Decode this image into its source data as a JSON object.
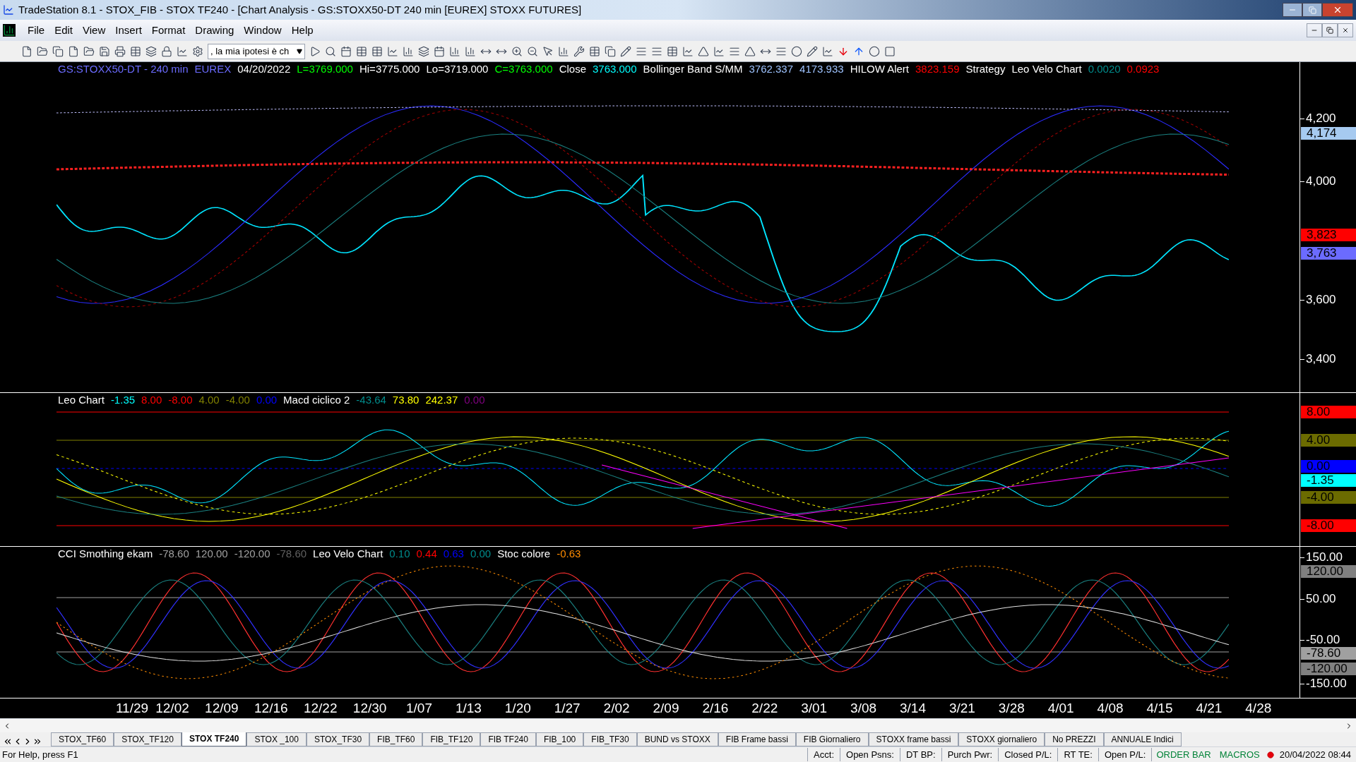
{
  "window": {
    "title": "TradeStation 8.1 - STOX_FIB - STOX TF240 - [Chart Analysis - GS:STOXX50-DT  240 min  [EUREX] STOXX FUTURES]"
  },
  "menu": [
    "File",
    "Edit",
    "View",
    "Insert",
    "Format",
    "Drawing",
    "Window",
    "Help"
  ],
  "toolbar": {
    "combo_value": ", la mia ipotesi è ch"
  },
  "price_pane": {
    "legend": [
      {
        "text": "GS:STOXX50-DT - 240 min",
        "color": "#6b6bff"
      },
      {
        "text": "EUREX",
        "color": "#6b6bff"
      },
      {
        "text": "04/20/2022",
        "color": "#ffffff"
      },
      {
        "text": "L=3769.000",
        "color": "#00ff00"
      },
      {
        "text": "Hi=3775.000",
        "color": "#ffffff"
      },
      {
        "text": "Lo=3719.000",
        "color": "#ffffff"
      },
      {
        "text": "C=3763.000",
        "color": "#00ff00"
      },
      {
        "text": "Close",
        "color": "#ffffff"
      },
      {
        "text": "3763.000",
        "color": "#00ffff"
      },
      {
        "text": "Bollinger Band S/MM",
        "color": "#ffffff"
      },
      {
        "text": "3762.337",
        "color": "#9ec3ff"
      },
      {
        "text": "4173.933",
        "color": "#9ec3ff"
      },
      {
        "text": "HILOW Alert",
        "color": "#ffffff"
      },
      {
        "text": "3823.159",
        "color": "#ff0000"
      },
      {
        "text": "Strategy",
        "color": "#ffffff"
      },
      {
        "text": "Leo Velo Chart",
        "color": "#ffffff"
      },
      {
        "text": "0.0020",
        "color": "#008b8b"
      },
      {
        "text": "0.0923",
        "color": "#ff0000"
      }
    ],
    "ticks": [
      "4,200",
      "4,000",
      "3,600",
      "3,400"
    ],
    "markers": [
      {
        "text": "4,174",
        "color": "#a6caf0"
      },
      {
        "text": "3,823",
        "color": "#ff0000"
      },
      {
        "text": "3,763",
        "color": "#6b6bff"
      }
    ]
  },
  "leo_pane": {
    "legend": [
      {
        "text": "Leo Chart",
        "color": "#ffffff"
      },
      {
        "text": "-1.35",
        "color": "#00ffff"
      },
      {
        "text": "8.00",
        "color": "#ff0000"
      },
      {
        "text": "-8.00",
        "color": "#ff0000"
      },
      {
        "text": "4.00",
        "color": "#808000"
      },
      {
        "text": "-4.00",
        "color": "#808000"
      },
      {
        "text": "0.00",
        "color": "#0000ff"
      },
      {
        "text": "Macd ciclico 2",
        "color": "#ffffff"
      },
      {
        "text": "-43.64",
        "color": "#008b8b"
      },
      {
        "text": "73.80",
        "color": "#ffff00"
      },
      {
        "text": "242.37",
        "color": "#ffff00"
      },
      {
        "text": "0.00",
        "color": "#800080"
      }
    ],
    "markers": [
      {
        "text": "8.00",
        "color": "#ff0000"
      },
      {
        "text": "4.00",
        "color": "#6b6b00"
      },
      {
        "text": "0.00",
        "color": "#0000ff"
      },
      {
        "text": "-1.35",
        "color": "#00ffff"
      },
      {
        "text": "-4.00",
        "color": "#6b6b00"
      },
      {
        "text": "-8.00",
        "color": "#ff0000"
      }
    ]
  },
  "cci_pane": {
    "legend": [
      {
        "text": "CCI Smothing ekam",
        "color": "#ffffff"
      },
      {
        "text": "-78.60",
        "color": "#a0a0a0"
      },
      {
        "text": "120.00",
        "color": "#a0a0a0"
      },
      {
        "text": "-120.00",
        "color": "#a0a0a0"
      },
      {
        "text": "-78.60",
        "color": "#606060"
      },
      {
        "text": "Leo Velo Chart",
        "color": "#ffffff"
      },
      {
        "text": "0.10",
        "color": "#008b8b"
      },
      {
        "text": "0.44",
        "color": "#ff0000"
      },
      {
        "text": "0.63",
        "color": "#0000ff"
      },
      {
        "text": "0.00",
        "color": "#008b8b"
      },
      {
        "text": "Stoc colore",
        "color": "#ffffff"
      },
      {
        "text": "-0.63",
        "color": "#ff8c00"
      }
    ],
    "ticks": [
      "150.00",
      "50.00",
      "-50.00",
      "-150.00"
    ],
    "markers": [
      {
        "text": "120.00",
        "color": "#808080"
      },
      {
        "text": "-78.60",
        "color": "#a0a0a0"
      },
      {
        "text": "-120.00",
        "color": "#808080"
      }
    ]
  },
  "x_axis": [
    "11/29",
    "12/02",
    "12/09",
    "12/16",
    "12/22",
    "12/30",
    "1/07",
    "1/13",
    "1/20",
    "1/27",
    "2/02",
    "2/09",
    "2/16",
    "2/22",
    "3/01",
    "3/08",
    "3/14",
    "3/21",
    "3/28",
    "4/01",
    "4/08",
    "4/15",
    "4/21",
    "4/28"
  ],
  "sheet_tabs": [
    {
      "label": "STOX_TF60",
      "selected": false
    },
    {
      "label": "STOX_TF120",
      "selected": false
    },
    {
      "label": "STOX TF240",
      "selected": true
    },
    {
      "label": "STOX _100",
      "selected": false
    },
    {
      "label": "STOX_TF30",
      "selected": false
    },
    {
      "label": "FIB_TF60",
      "selected": false
    },
    {
      "label": "FIB_TF120",
      "selected": false
    },
    {
      "label": "FIB TF240",
      "selected": false
    },
    {
      "label": "FIB_100",
      "selected": false
    },
    {
      "label": "FIB_TF30",
      "selected": false
    },
    {
      "label": "BUND vs STOXX",
      "selected": false
    },
    {
      "label": "FIB Frame bassi",
      "selected": false
    },
    {
      "label": "FIB Giornaliero",
      "selected": false
    },
    {
      "label": "STOXX frame bassi",
      "selected": false
    },
    {
      "label": "STOXX giornaliero",
      "selected": false
    },
    {
      "label": "No PREZZI",
      "selected": false
    },
    {
      "label": "ANNUALE Indici",
      "selected": false
    }
  ],
  "status_bar": {
    "help": "For Help, press F1",
    "fields": [
      "Acct:",
      "Open Psns:",
      "DT BP:",
      "Purch Pwr:",
      "Closed P/L:",
      "RT TE:",
      "Open P/L:"
    ],
    "order_bar": "ORDER BAR",
    "macros": "MACROS",
    "datetime": "20/04/2022 08:44"
  }
}
